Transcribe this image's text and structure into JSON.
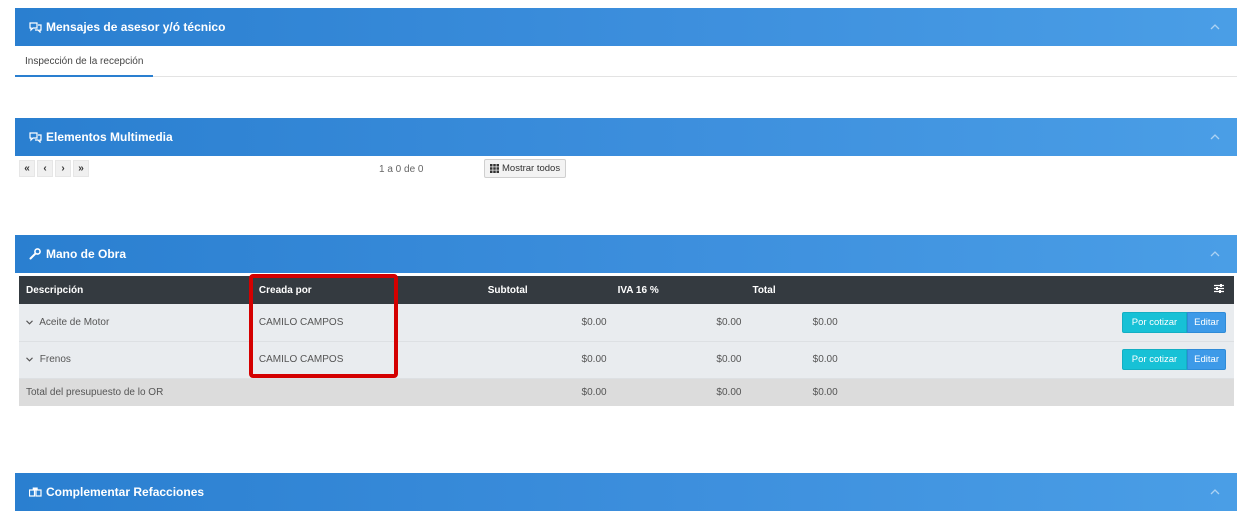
{
  "panels": {
    "mensajes": {
      "title": "Mensajes de asesor y/ó técnico",
      "tab": "Inspección de la recepción"
    },
    "multimedia": {
      "title": "Elementos Multimedia",
      "pager_count": "1 a 0 de 0",
      "show_all": "Mostrar todos",
      "pager": {
        "first": "«",
        "prev": "‹",
        "next": "›",
        "last": "»"
      }
    },
    "mano_obra": {
      "title": "Mano de Obra"
    },
    "refacciones": {
      "title": "Complementar Refacciones"
    }
  },
  "table": {
    "headers": {
      "descripcion": "Descripción",
      "creada_por": "Creada por",
      "subtotal": "Subtotal",
      "iva": "IVA 16 %",
      "total": "Total"
    },
    "rows": [
      {
        "descripcion": "Aceite de Motor",
        "creada_por": "CAMILO CAMPOS",
        "subtotal": "$0.00",
        "iva": "$0.00",
        "total": "$0.00",
        "btn_cotizar": "Por cotizar",
        "btn_editar": "Editar"
      },
      {
        "descripcion": "Frenos",
        "creada_por": "CAMILO CAMPOS",
        "subtotal": "$0.00",
        "iva": "$0.00",
        "total": "$0.00",
        "btn_cotizar": "Por cotizar",
        "btn_editar": "Editar"
      }
    ],
    "footer": {
      "label": "Total del presupuesto de lo OR",
      "subtotal": "$0.00",
      "iva": "$0.00",
      "total": "$0.00"
    }
  },
  "colors": {
    "header_blue": "#2a7fd0",
    "table_head": "#343a40",
    "highlight": "#d40000",
    "btn_cotizar": "#17c1d6",
    "btn_editar": "#3d9ae8"
  }
}
